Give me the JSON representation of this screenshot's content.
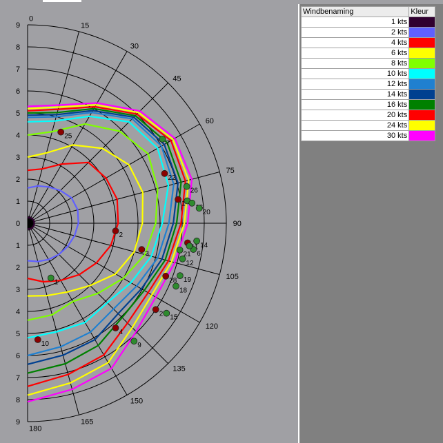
{
  "chart_data": {
    "type": "polar",
    "title": "",
    "angle_labels": [
      "0",
      "15",
      "30",
      "45",
      "60",
      "75",
      "90",
      "105",
      "120",
      "135",
      "150",
      "165",
      "180"
    ],
    "radius_tick_labels": [
      "9",
      "8",
      "7",
      "6",
      "5",
      "4",
      "3",
      "2",
      "1",
      "0",
      "1",
      "2",
      "3",
      "4",
      "5",
      "6",
      "7",
      "8",
      "9"
    ],
    "radius_max": 9,
    "grid": true,
    "legend_position": "top-right",
    "series": [
      {
        "name": "1 kts",
        "color": "#300030",
        "values": [
          0.25,
          0.27,
          0.28,
          0.29,
          0.3,
          0.3,
          0.3,
          0.3,
          0.3,
          0.29,
          0.28,
          0.27,
          0.25
        ]
      },
      {
        "name": "2 kts",
        "color": "#6060ff",
        "values": [
          1.6,
          1.75,
          1.9,
          2.1,
          2.3,
          2.35,
          2.3,
          2.2,
          2.1,
          2.0,
          1.9,
          1.8,
          1.7
        ]
      },
      {
        "name": "4 kts",
        "color": "#ff0000",
        "values": [
          2.4,
          2.55,
          3.1,
          3.9,
          4.1,
          4.2,
          4.1,
          3.9,
          3.6,
          3.3,
          3.0,
          2.75,
          2.5
        ]
      },
      {
        "name": "6 kts",
        "color": "#ffff00",
        "values": [
          3.0,
          3.3,
          4.1,
          4.8,
          5.3,
          5.4,
          5.2,
          5.0,
          4.6,
          4.0,
          3.6,
          3.4,
          3.3
        ]
      },
      {
        "name": "8 kts",
        "color": "#80ff00",
        "values": [
          4.0,
          4.3,
          5.2,
          5.9,
          6.3,
          6.1,
          5.8,
          5.5,
          5.0,
          4.5,
          4.1,
          4.3,
          4.4
        ]
      },
      {
        "name": "10 kts",
        "color": "#00ffff",
        "values": [
          4.6,
          4.8,
          5.6,
          6.5,
          6.8,
          6.6,
          6.1,
          5.8,
          5.4,
          5.1,
          5.2,
          5.1,
          5.2
        ]
      },
      {
        "name": "12 kts",
        "color": "#2080d0",
        "values": [
          4.8,
          5.0,
          5.8,
          6.7,
          7.0,
          6.85,
          6.4,
          6.1,
          5.7,
          5.5,
          5.7,
          5.8,
          6.0
        ]
      },
      {
        "name": "14 kts",
        "color": "#004090",
        "values": [
          4.9,
          5.1,
          5.9,
          6.8,
          7.15,
          7.05,
          6.6,
          6.3,
          5.95,
          5.8,
          6.1,
          6.2,
          6.4
        ]
      },
      {
        "name": "16 kts",
        "color": "#008000",
        "values": [
          5.0,
          5.2,
          6.0,
          6.9,
          7.3,
          7.2,
          6.75,
          6.45,
          6.1,
          6.05,
          6.4,
          6.6,
          6.8
        ]
      },
      {
        "name": "20 kts",
        "color": "#ff0000",
        "values": [
          5.1,
          5.35,
          6.1,
          7.0,
          7.5,
          7.4,
          6.95,
          6.6,
          6.3,
          6.4,
          6.9,
          7.1,
          7.4
        ]
      },
      {
        "name": "24 kts",
        "color": "#ffff00",
        "values": [
          5.2,
          5.45,
          6.2,
          7.1,
          7.6,
          7.55,
          7.1,
          6.75,
          6.5,
          6.7,
          7.3,
          7.5,
          7.8
        ]
      },
      {
        "name": "30 kts",
        "color": "#ff00ff",
        "values": [
          5.3,
          5.55,
          6.3,
          7.2,
          7.7,
          7.7,
          7.25,
          6.9,
          6.7,
          6.95,
          7.6,
          7.8,
          8.1
        ]
      }
    ],
    "points": [
      {
        "label": "25",
        "angle": 20,
        "r": 4.4,
        "color": "#8b0000"
      },
      {
        "label": "7",
        "angle": 58,
        "r": 7.2,
        "color": "#2e8b2e"
      },
      {
        "label": "22",
        "angle": 70,
        "r": 6.6,
        "color": "#8b0000"
      },
      {
        "label": "26",
        "angle": 77,
        "r": 7.4,
        "color": "#2e8b2e"
      },
      {
        "label": "1",
        "angle": 81,
        "r": 6.9,
        "color": "#8b0000"
      },
      {
        "label": "",
        "angle": 82,
        "r": 7.3,
        "color": "#2e8b2e"
      },
      {
        "label": "16",
        "angle": 83,
        "r": 7.5,
        "color": "#2e8b2e"
      },
      {
        "label": "20",
        "angle": 85,
        "r": 7.8,
        "color": "#2e8b2e"
      },
      {
        "label": "2",
        "angle": 95,
        "r": 4.0,
        "color": "#8b0000"
      },
      {
        "label": "3",
        "angle": 103,
        "r": 5.3,
        "color": "#8b0000"
      },
      {
        "label": "14",
        "angle": 96,
        "r": 7.7,
        "color": "#2e8b2e"
      },
      {
        "label": "11",
        "angle": 97,
        "r": 7.3,
        "color": "#8b0000"
      },
      {
        "label": "6",
        "angle": 99,
        "r": 7.6,
        "color": "#2e8b2e"
      },
      {
        "label": "",
        "angle": 98,
        "r": 7.4,
        "color": "#2e8b2e"
      },
      {
        "label": "21",
        "angle": 100,
        "r": 7.0,
        "color": "#2e8b2e"
      },
      {
        "label": "12",
        "angle": 103,
        "r": 7.2,
        "color": "#2e8b2e"
      },
      {
        "label": "28",
        "angle": 111,
        "r": 6.7,
        "color": "#8b0000"
      },
      {
        "label": "19",
        "angle": 109,
        "r": 7.3,
        "color": "#2e8b2e"
      },
      {
        "label": "18",
        "angle": 113,
        "r": 7.3,
        "color": "#2e8b2e"
      },
      {
        "label": "27",
        "angle": 124,
        "r": 7.0,
        "color": "#8b0000"
      },
      {
        "label": "15",
        "angle": 123,
        "r": 7.5,
        "color": "#2e8b2e"
      },
      {
        "label": "4",
        "angle": 140,
        "r": 6.2,
        "color": "#8b0000"
      },
      {
        "label": "9",
        "angle": 138,
        "r": 7.2,
        "color": "#2e8b2e"
      },
      {
        "label": "1",
        "angle": 157,
        "r": 2.7,
        "color": "#2e8b2e"
      },
      {
        "label": "10",
        "angle": 175,
        "r": 5.3,
        "color": "#8b0000"
      }
    ]
  },
  "legend": {
    "header_name": "Windbenaming",
    "header_color": "Kleur",
    "rows": [
      {
        "name": "1 kts",
        "color": "#300030"
      },
      {
        "name": "2 kts",
        "color": "#6060ff"
      },
      {
        "name": "4 kts",
        "color": "#ff0000"
      },
      {
        "name": "6 kts",
        "color": "#ffff00"
      },
      {
        "name": "8 kts",
        "color": "#80ff00"
      },
      {
        "name": "10 kts",
        "color": "#00ffff"
      },
      {
        "name": "12 kts",
        "color": "#2080d0"
      },
      {
        "name": "14 kts",
        "color": "#004090"
      },
      {
        "name": "16 kts",
        "color": "#008000"
      },
      {
        "name": "20 kts",
        "color": "#ff0000"
      },
      {
        "name": "24 kts",
        "color": "#ffff00"
      },
      {
        "name": "30 kts",
        "color": "#ff00ff"
      }
    ]
  }
}
